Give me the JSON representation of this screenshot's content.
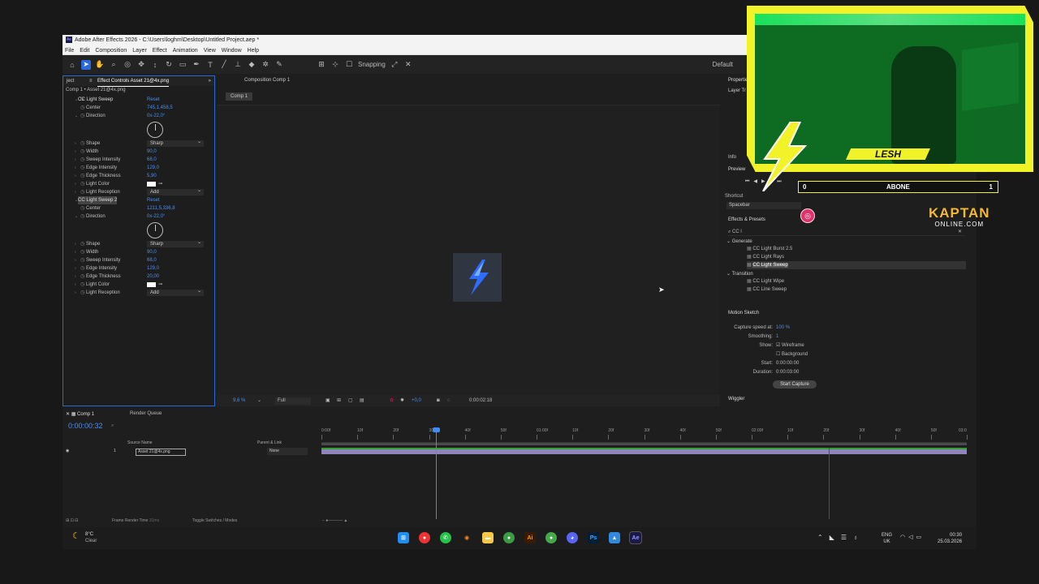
{
  "window": {
    "title": "Adobe After Effects 2026 - C:\\Users\\loghm\\Desktop\\Untitled Project.aep *",
    "app_badge": "Ae"
  },
  "menu": [
    "File",
    "Edit",
    "Composition",
    "Layer",
    "Effect",
    "Animation",
    "View",
    "Window",
    "Help"
  ],
  "toolbar": {
    "snapping": "Snapping",
    "workspace": "Default"
  },
  "project_panel": {
    "tab_label": "ject"
  },
  "effect_controls": {
    "tab": "Effect Controls Asset 21@4x.png",
    "subtitle": "Comp 1 • Asset 21@4x.png",
    "effect1": {
      "name": "CC Light Sweep",
      "reset": "Reset"
    },
    "effect2": {
      "name": "CC Light Sweep 2",
      "reset": "Reset"
    },
    "rows1": [
      {
        "name": "Center",
        "value": "745,1,458,5"
      },
      {
        "name": "Direction",
        "value": "0x-22,0°"
      },
      {
        "name": "Shape",
        "value": "Sharp"
      },
      {
        "name": "Width",
        "value": "90,0"
      },
      {
        "name": "Sweep Intensity",
        "value": "68,0"
      },
      {
        "name": "Edge Intensity",
        "value": "129,0"
      },
      {
        "name": "Edge Thickness",
        "value": "5,90"
      },
      {
        "name": "Light Color",
        "value": ""
      },
      {
        "name": "Light Reception",
        "value": "Add"
      }
    ],
    "rows2": [
      {
        "name": "Center",
        "value": "1211,5,336,8"
      },
      {
        "name": "Direction",
        "value": "0x-22,0°"
      },
      {
        "name": "Shape",
        "value": "Sharp"
      },
      {
        "name": "Width",
        "value": "90,0"
      },
      {
        "name": "Sweep Intensity",
        "value": "68,0"
      },
      {
        "name": "Edge Intensity",
        "value": "129,0"
      },
      {
        "name": "Edge Thickness",
        "value": "20,00"
      },
      {
        "name": "Light Color",
        "value": ""
      },
      {
        "name": "Light Reception",
        "value": "Add"
      }
    ]
  },
  "composition": {
    "tab": "Composition Comp 1",
    "chip": "Comp 1",
    "zoom": "9,6 %",
    "quality": "Full",
    "exposure": "+0,0",
    "timecode": "0:00:02:18"
  },
  "properties": {
    "title": "Properties",
    "layer_label": "Layer Tr",
    "info": "Info",
    "preview": "Preview",
    "shortcut": "Shortcut",
    "shortcut_value": "Spacebar"
  },
  "effects_presets": {
    "title": "Effects & Presets",
    "search": "CC l",
    "categories": [
      {
        "name": "Generate",
        "items": [
          "CC Light Burst 2.5",
          "CC Light Rays",
          "CC Light Sweep"
        ]
      },
      {
        "name": "Transition",
        "items": [
          "CC Light Wipe",
          "CC Line Sweep"
        ]
      }
    ]
  },
  "motion_sketch": {
    "title": "Motion Sketch",
    "capture_label": "Capture speed at:",
    "capture_value": "100 %",
    "smoothing_label": "Smoothing:",
    "smoothing_value": "1",
    "show_label": "Show:",
    "wireframe": "Wireframe",
    "background": "Background",
    "start_label": "Start:",
    "start_value": "0:00:00:00",
    "duration_label": "Duration:",
    "duration_value": "0:00:03:00",
    "button": "Start Capture"
  },
  "wiggler": {
    "title": "Wiggler"
  },
  "timeline": {
    "tab": "Comp 1",
    "render_queue": "Render Queue",
    "timecode": "0:00:00:32",
    "col_source": "Source Name",
    "col_parent": "Parent & Link",
    "layer_num": "1",
    "layer_name": "Asset 21@4x.png",
    "parent": "None",
    "ticks": [
      "0:00f",
      "10f",
      "20f",
      "30f",
      "40f",
      "50f",
      "01:00f",
      "10f",
      "20f",
      "30f",
      "40f",
      "50f",
      "02:00f",
      "10f",
      "20f",
      "30f",
      "40f",
      "50f",
      "03:0"
    ],
    "footer_render": "Frame Render Time",
    "footer_render_value": "31ms",
    "footer_toggle": "Toggle Switches / Modes"
  },
  "taskbar": {
    "weather_temp": "8°C",
    "weather_text": "Clear",
    "lang1": "ENG",
    "lang2": "UK",
    "time": "00:30",
    "date": "25.03.2026"
  },
  "overlay": {
    "streamer": "LESH",
    "sub_left": "0",
    "sub_label": "ABONE",
    "sub_right": "1",
    "brand": "KAPTAN",
    "brand_sub": "ONLINE.COM"
  },
  "colors": {
    "accent": "#2a6ad8",
    "value_blue": "#4a8ff0",
    "overlay_yellow": "#f2f228",
    "playhead": "#3a8cff",
    "work_end": "#c0202a"
  }
}
